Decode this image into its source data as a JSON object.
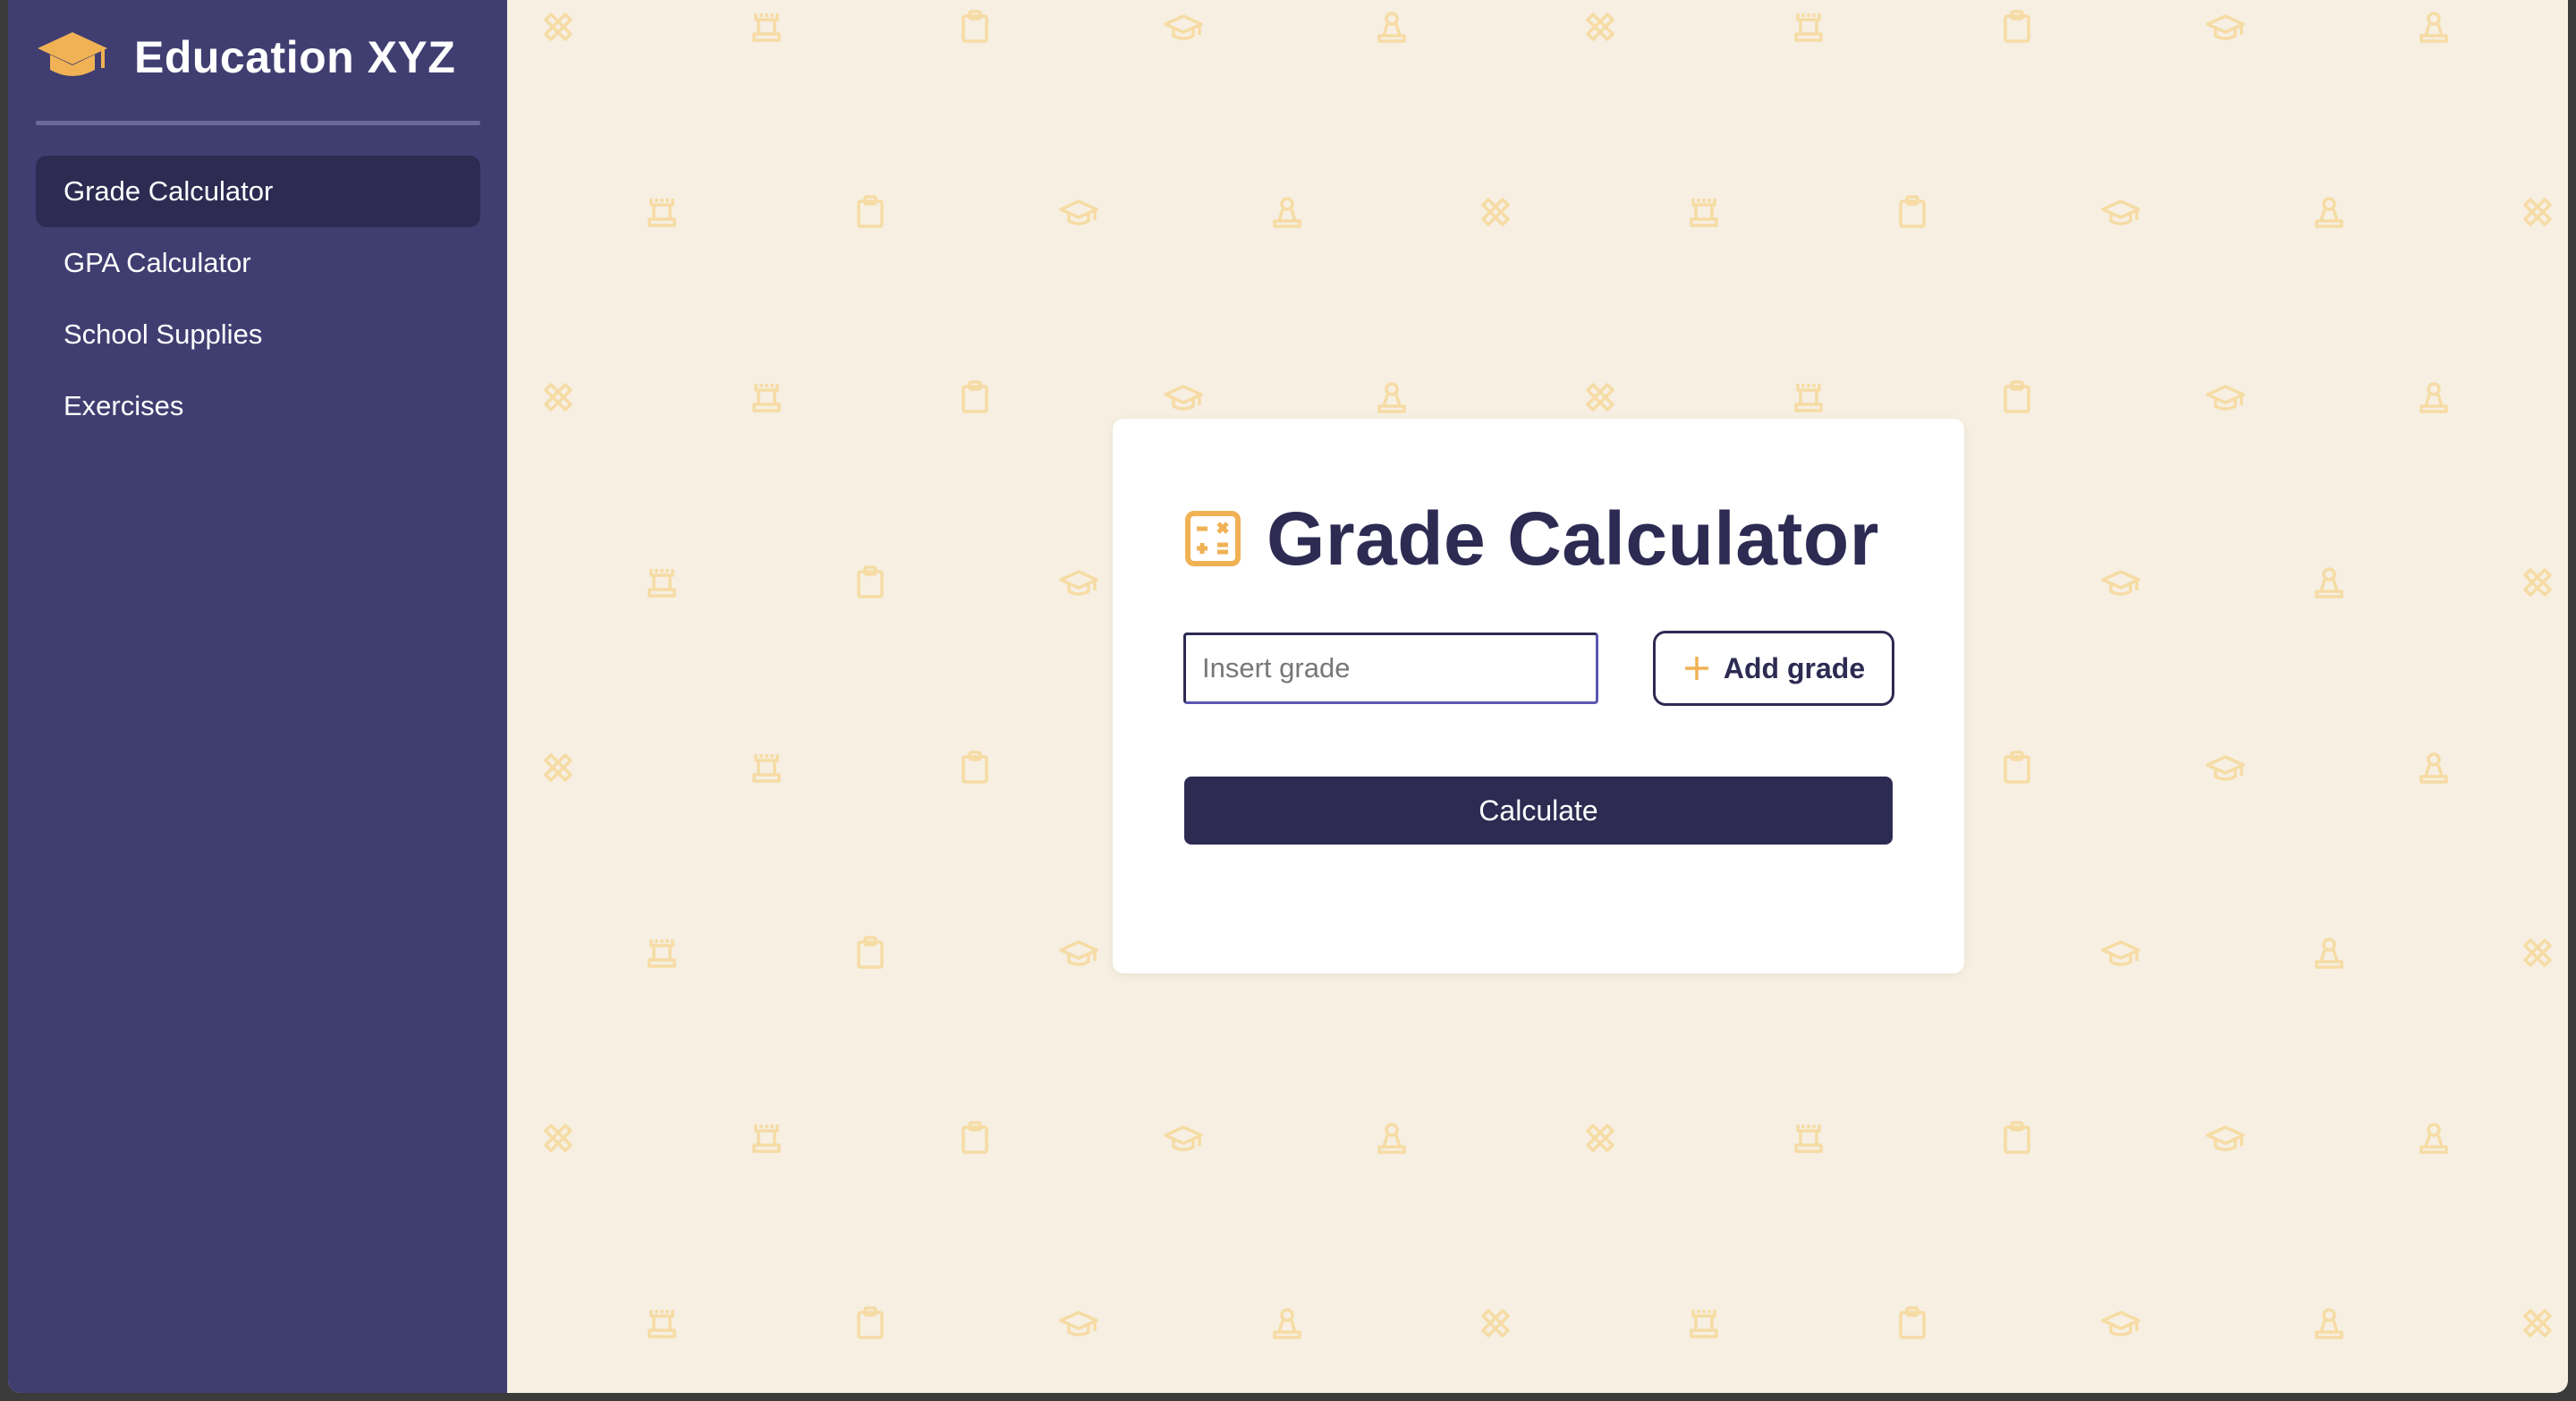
{
  "app": {
    "brand_title": "Education XYZ",
    "brand_icon": "graduation-cap-icon"
  },
  "sidebar": {
    "items": [
      {
        "label": "Grade Calculator",
        "active": true
      },
      {
        "label": "GPA Calculator",
        "active": false
      },
      {
        "label": "School Supplies",
        "active": false
      },
      {
        "label": "Exercises",
        "active": false
      }
    ]
  },
  "main": {
    "title": "Grade Calculator",
    "title_icon": "calculator-icon",
    "grade_input": {
      "value": "",
      "placeholder": "Insert grade"
    },
    "add_grade_label": "Add grade",
    "calculate_label": "Calculate"
  },
  "background": {
    "pattern_icons": [
      "pencil-ruler-icon",
      "chess-rook-icon",
      "clipboard-icon",
      "graduation-cap-icon",
      "chess-pawn-icon"
    ]
  },
  "colors": {
    "sidebar": "#403e71",
    "sidebar_active": "#2d2b52",
    "primary": "#2d2b52",
    "accent": "#f0b255",
    "page_background": "#f6efe2"
  }
}
